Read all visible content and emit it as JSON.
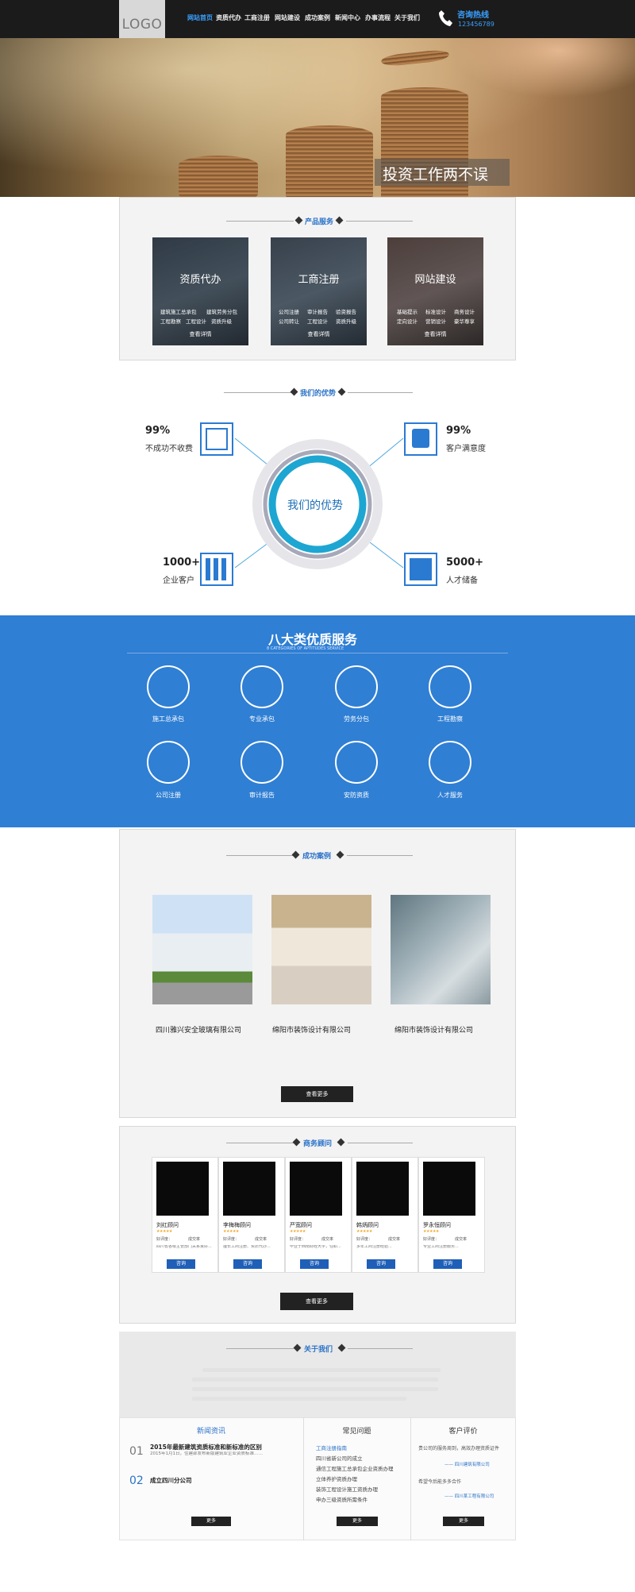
{
  "header": {
    "logo": "LOGO",
    "nav": [
      "网站首页",
      "资质代办",
      "工商注册",
      "网站建设",
      "成功案例",
      "新闻中心",
      "办事流程",
      "关于我们"
    ],
    "hotline_label": "咨询热线",
    "hotline_number": "123456789"
  },
  "banner": {
    "slogan": "投资工作两不误"
  },
  "products": {
    "title": "产品服务",
    "cards": [
      {
        "title": "资质代办",
        "items": [
          "建筑施工总承包",
          "建筑劳务分包",
          "工程勘察",
          "工程设计",
          "资质升级"
        ],
        "more": "查看详情"
      },
      {
        "title": "工商注册",
        "items": [
          "公司注册",
          "审计报告",
          "验资报告",
          "公司转让",
          "工程设计",
          "资质升级"
        ],
        "more": "查看详情"
      },
      {
        "title": "网站建设",
        "items": [
          "基础提示",
          "标准设计",
          "商务设计",
          "定向设计",
          "营销设计",
          "豪华尊享"
        ],
        "more": "查看详情"
      }
    ]
  },
  "advantages": {
    "title": "我们的优势",
    "center": "我们的优势",
    "items": [
      {
        "value": "99%",
        "label": "不成功不收费"
      },
      {
        "value": "99%",
        "label": "客户满意度"
      },
      {
        "value": "1000+",
        "label": "企业客户"
      },
      {
        "value": "5000+",
        "label": "人才储备"
      }
    ]
  },
  "services": {
    "title": "八大类优质服务",
    "subtitle": "8 CATEGORIES OF APTITUDES SERVICE",
    "items": [
      "施工总承包",
      "专业承包",
      "劳务分包",
      "工程勘察",
      "公司注册",
      "审计报告",
      "安防资质",
      "人才服务"
    ]
  },
  "cases": {
    "title": "成功案例",
    "items": [
      "四川雅兴安全玻璃有限公司",
      "绵阳市装饰设计有限公司",
      "绵阳市装饰设计有限公司"
    ],
    "more": "查看更多"
  },
  "consultants": {
    "title": "商务顾问",
    "items": [
      {
        "name": "刘红顾问",
        "stars": "★★★★★",
        "rating": "好评度：",
        "count": "成交率",
        "desc": "四川省各级主管部门关系良好...",
        "btn": "咨询"
      },
      {
        "name": "李梅梅顾问",
        "stars": "★★★★★",
        "rating": "好评度：",
        "count": "成交率",
        "desc": "擅长工商注册、资质代办...",
        "btn": "咨询"
      },
      {
        "name": "严宽顾问",
        "stars": "★★★★★",
        "rating": "好评度：",
        "count": "成交率",
        "desc": "毕业于西南财经大学，任职...",
        "btn": "咨询"
      },
      {
        "name": "韩炳顾问",
        "stars": "★★★★★",
        "rating": "好评度：",
        "count": "成交率",
        "desc": "多年工商注册经验...",
        "btn": "咨询"
      },
      {
        "name": "罗永恒顾问",
        "stars": "★★★★★",
        "rating": "好评度：",
        "count": "成交率",
        "desc": "专业工商注册服务...",
        "btn": "咨询"
      }
    ],
    "more": "查看更多"
  },
  "about": {
    "title": "关于我们",
    "news": {
      "title": "新闻资讯",
      "items": [
        {
          "num": "01",
          "title": "2015年最新建筑资质标准和新标准的区别",
          "desc": "2015年1月1日，住建部发布新版建筑业企业资质标准……"
        },
        {
          "num": "02",
          "title": "成立四川分公司",
          "desc": ""
        }
      ],
      "more": "更多"
    },
    "faq": {
      "title": "常见问题",
      "items": [
        "工商注册指南",
        "四川省新公司的成立",
        "通信工程施工总承包企业资质办理",
        "立体养护资质办理",
        "装饰工程设计施工资质办理",
        "申办三级资质所需条件"
      ],
      "more": "更多"
    },
    "reviews": {
      "title": "客户评价",
      "items": [
        {
          "text": "贵公司的服务周到，高效办理资质证件",
          "author": "—— 四川建筑有限公司"
        },
        {
          "text": "希望今后能多多合作",
          "author": "—— 四川某工程有限公司"
        }
      ],
      "more": "更多"
    }
  }
}
